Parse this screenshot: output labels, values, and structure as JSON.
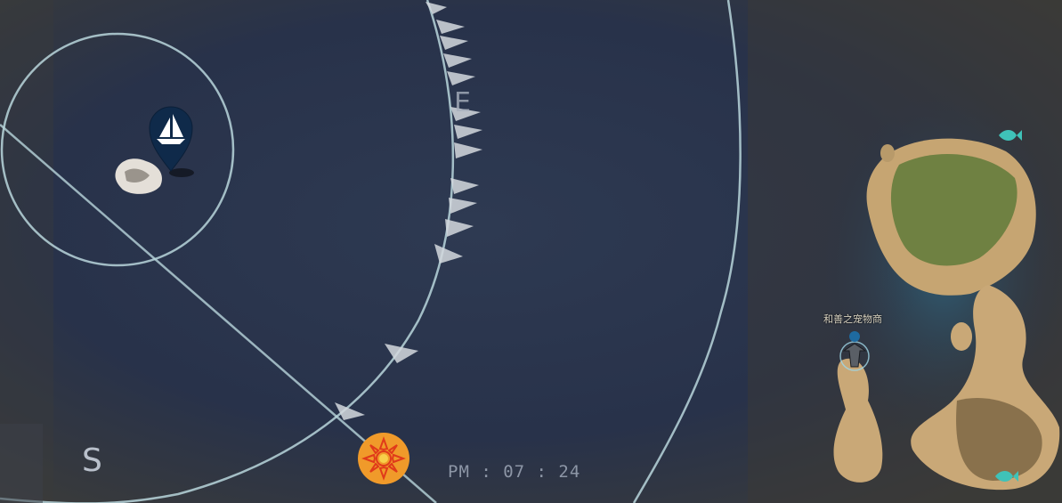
{
  "compass": {
    "south": "S",
    "east": "E"
  },
  "clock": {
    "time": "PM : 07 : 24"
  },
  "npc": {
    "name": "和善之宠物商"
  },
  "icons": {
    "player_marker": "sailboat-marker-icon",
    "sun": "sun-icon",
    "npc": "npc-marker-icon",
    "shipwreck": "shipwreck-icon",
    "fish": "fish-icon"
  },
  "colors": {
    "sea": "#2a3346",
    "sea_deep": "#1f2838",
    "ring": "#b9d6dc",
    "island_sand": "#c9a877",
    "island_grass": "#5f7a3a",
    "marker": "#0f2a4a",
    "sun_orange": "#f09a2a",
    "sun_red": "#e03a1a"
  }
}
